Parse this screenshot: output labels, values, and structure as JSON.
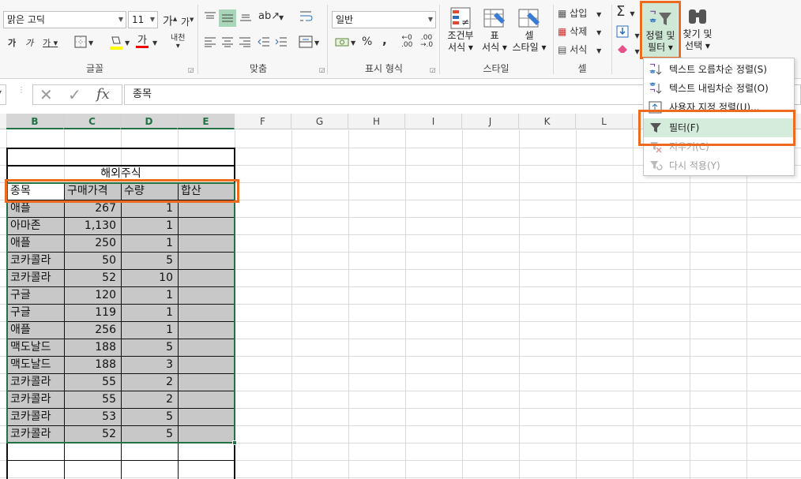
{
  "ribbon": {
    "font": {
      "name": "맑은 고딕",
      "size": "11",
      "grow_label": "가",
      "shrink_label": "가",
      "bold": "가",
      "italic": "가",
      "underline": "가",
      "font_color_label": "가",
      "phonetic": "내천",
      "group_label": "글꼴"
    },
    "alignment": {
      "group_label": "맞춤"
    },
    "number": {
      "format": "일반",
      "percent": "%",
      "comma": ",",
      "group_label": "표시 형식"
    },
    "styles": {
      "conditional": [
        "조건부",
        "서식 ▾"
      ],
      "table": [
        "표",
        "서식 ▾"
      ],
      "cell": [
        "셀",
        "스타일 ▾"
      ],
      "group_label": "스타일"
    },
    "cells": {
      "insert": "삽입",
      "delete": "삭제",
      "format": "서식",
      "group_label": "셀"
    },
    "editing": {
      "sort_filter": [
        "정렬 및",
        "필터 ▾"
      ],
      "find_select": [
        "찾기 및",
        "선택 ▾"
      ]
    }
  },
  "formula_bar": {
    "content": "종목"
  },
  "columns": [
    "B",
    "C",
    "D",
    "E",
    "F",
    "G",
    "H",
    "I",
    "J",
    "K",
    "L"
  ],
  "sheet": {
    "title": "해외주식",
    "headers": [
      "종목",
      "구매가격",
      "수량",
      "합산"
    ],
    "rows": [
      [
        "애플",
        "267",
        "1",
        ""
      ],
      [
        "아마존",
        "1,130",
        "1",
        ""
      ],
      [
        "애플",
        "250",
        "1",
        ""
      ],
      [
        "코카콜라",
        "50",
        "5",
        ""
      ],
      [
        "코카콜라",
        "52",
        "10",
        ""
      ],
      [
        "구글",
        "120",
        "1",
        ""
      ],
      [
        "구글",
        "119",
        "1",
        ""
      ],
      [
        "애플",
        "256",
        "1",
        ""
      ],
      [
        "맥도날드",
        "188",
        "5",
        ""
      ],
      [
        "맥도날드",
        "188",
        "3",
        ""
      ],
      [
        "코카콜라",
        "55",
        "2",
        ""
      ],
      [
        "코카콜라",
        "55",
        "2",
        ""
      ],
      [
        "코카콜라",
        "53",
        "5",
        ""
      ],
      [
        "코카콜라",
        "52",
        "5",
        ""
      ]
    ]
  },
  "sort_menu": {
    "items": [
      {
        "label": "텍스트 오름차순 정렬(S)",
        "icon": "sort-ascending-icon"
      },
      {
        "label": "텍스트 내림차순 정렬(O)",
        "icon": "sort-descending-icon"
      },
      {
        "label": "사용자 지정 정렬(U)...",
        "icon": "custom-sort-icon"
      },
      {
        "label": "필터(F)",
        "icon": "filter-icon"
      },
      {
        "label": "지우기(C)",
        "icon": "clear-filter-icon"
      },
      {
        "label": "다시 적용(Y)",
        "icon": "reapply-icon"
      }
    ]
  },
  "colors": {
    "highlight": "#ec6b1e",
    "selection": "#c8c8c8",
    "accent": "#217346"
  }
}
